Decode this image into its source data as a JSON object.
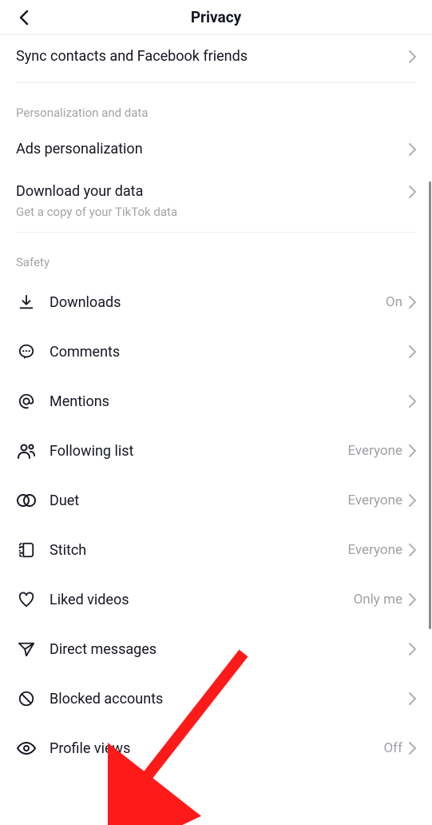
{
  "header": {
    "title": "Privacy"
  },
  "sections": {
    "sync": {
      "label": "Sync contacts and Facebook friends"
    },
    "personalization": {
      "heading": "Personalization and data",
      "ads": "Ads personalization",
      "download": "Download your data",
      "download_sub": "Get a copy of your TikTok data"
    },
    "safety": {
      "heading": "Safety",
      "downloads": {
        "label": "Downloads",
        "value": "On"
      },
      "comments": {
        "label": "Comments"
      },
      "mentions": {
        "label": "Mentions"
      },
      "following": {
        "label": "Following list",
        "value": "Everyone"
      },
      "duet": {
        "label": "Duet",
        "value": "Everyone"
      },
      "stitch": {
        "label": "Stitch",
        "value": "Everyone"
      },
      "liked": {
        "label": "Liked videos",
        "value": "Only me"
      },
      "dm": {
        "label": "Direct messages"
      },
      "blocked": {
        "label": "Blocked accounts"
      },
      "profile_views": {
        "label": "Profile views",
        "value": "Off"
      }
    }
  }
}
